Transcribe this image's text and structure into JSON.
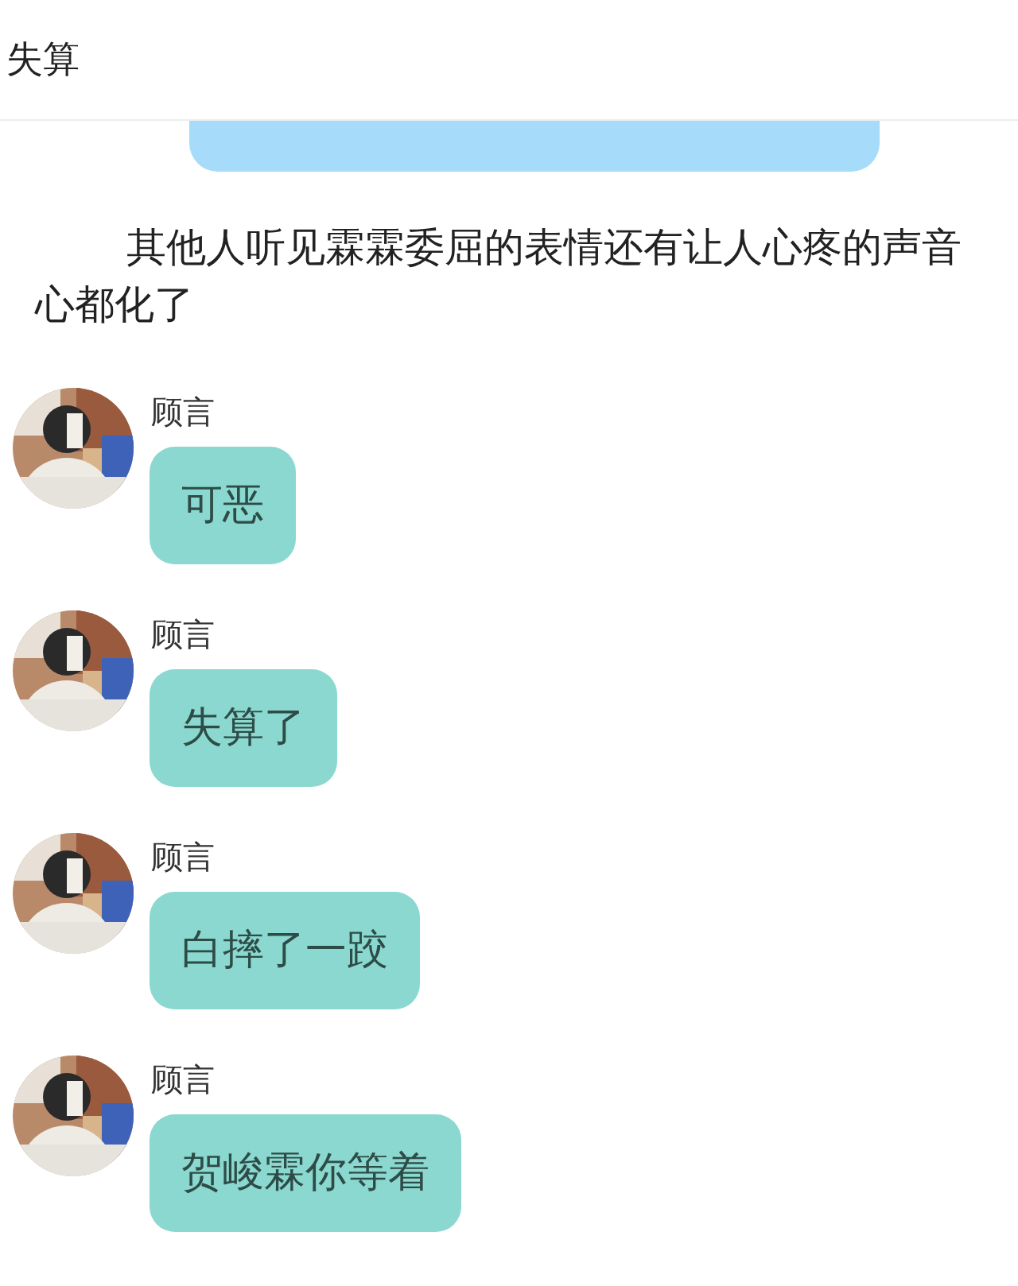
{
  "header": {
    "title": "失算"
  },
  "narration": "其他人听见霖霖委屈的表情还有让人心疼的声音心都化了",
  "messages": [
    {
      "sender": "顾言",
      "text": "可恶"
    },
    {
      "sender": "顾言",
      "text": "失算了"
    },
    {
      "sender": "顾言",
      "text": "白摔了一跤"
    },
    {
      "sender": "顾言",
      "text": "贺峻霖你等着"
    }
  ]
}
